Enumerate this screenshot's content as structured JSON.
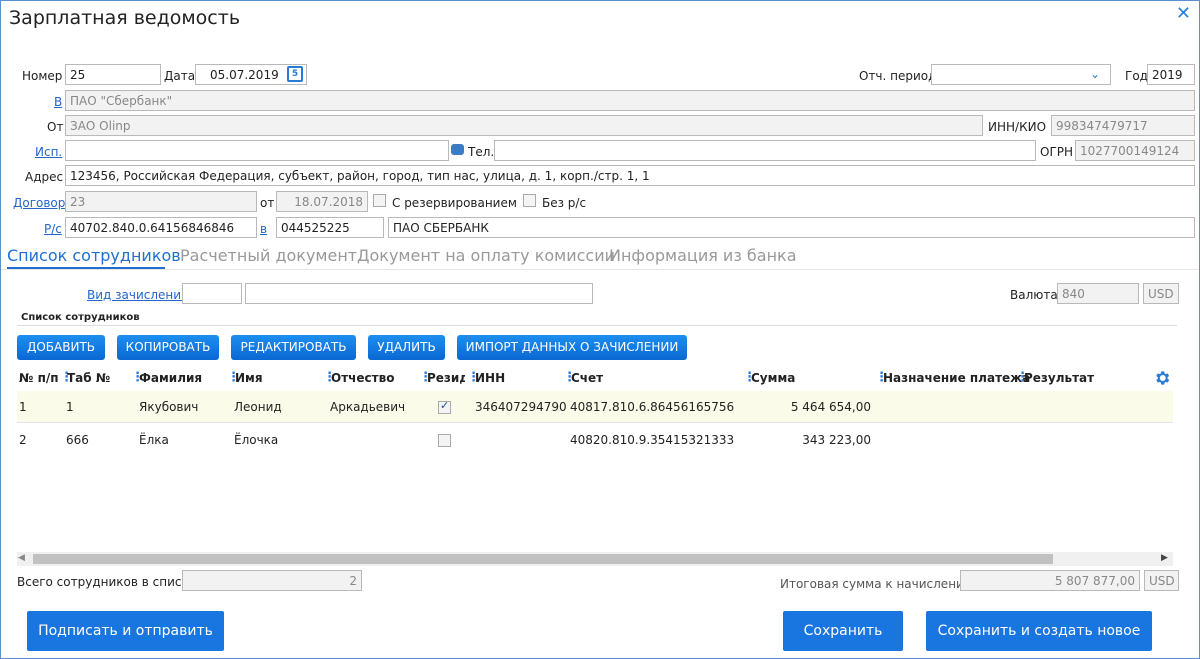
{
  "window": {
    "title": "Зарплатная ведомость"
  },
  "header": {
    "number_label": "Номер",
    "number_value": "25",
    "date_label": "Дата",
    "date_value": "05.07.2019",
    "period_label": "Отч. период",
    "period_value": "",
    "year_label": "Год",
    "year_value": "2019",
    "to_label": "В",
    "to_value": "ПАО \"Сбербанк\"",
    "from_label": "От",
    "from_value": "ЗАО Olinp",
    "inn_label": "ИНН/КИО",
    "inn_value": "998347479717",
    "exec_label": "Исп.",
    "exec_value": "",
    "tel_label": "Тел.",
    "tel_value": "",
    "ogrn_label": "ОГРН",
    "ogrn_value": "1027700149124",
    "address_label": "Адрес",
    "address_value": "123456, Российская Федерация, субъект, район, город, тип нас, улица, д. 1, корп./стр. 1, 1",
    "contract_label": "Договор",
    "contract_value": "23",
    "contract_from_label": "от",
    "contract_from_value": "18.07.2018",
    "reserve_label": "С резервированием",
    "no_account_label": "Без р/с",
    "account_label": "Р/с",
    "account_value": "40702.840.0.64156846846",
    "bank_label": "в",
    "bank_bic": "044525225",
    "bank_name": "ПАО СБЕРБАНК"
  },
  "tabs": [
    {
      "label": "Список сотрудников",
      "active": true
    },
    {
      "label": "Расчетный документ",
      "active": false
    },
    {
      "label": "Документ на оплату комиссии",
      "active": false
    },
    {
      "label": "Информация из банка",
      "active": false
    }
  ],
  "accrual": {
    "type_label": "Вид зачисления",
    "type_code": "",
    "type_name": "",
    "currency_label": "Валюта",
    "currency_code": "840",
    "currency_name": "USD"
  },
  "section_title": "Список сотрудников",
  "toolbar": {
    "add": "ДОБАВИТЬ",
    "copy": "КОПИРОВАТЬ",
    "edit": "РЕДАКТИРОВАТЬ",
    "delete": "УДАЛИТЬ",
    "import": "ИМПОРТ ДАННЫХ О ЗАЧИСЛЕНИИ"
  },
  "table": {
    "columns": [
      "№ п/п",
      "Таб №",
      "Фамилия",
      "Имя",
      "Отчество",
      "Резиде",
      "ИНН",
      "Счет",
      "Сумма",
      "Назначение платежа",
      "Результат"
    ],
    "rows": [
      {
        "num": "1",
        "tab": "1",
        "last": "Якубович",
        "first": "Леонид",
        "middle": "Аркадьевич",
        "resident": true,
        "inn": "346407294790",
        "account": "40817.810.6.86456165756",
        "sum": "5 464 654,00",
        "purpose": "",
        "result": ""
      },
      {
        "num": "2",
        "tab": "666",
        "last": "Ёлка",
        "first": "Ёлочка",
        "middle": "",
        "resident": false,
        "inn": "",
        "account": "40820.810.9.35415321333",
        "sum": "343 223,00",
        "purpose": "",
        "result": ""
      }
    ]
  },
  "footer": {
    "total_employees_label": "Всего сотрудников в списке",
    "total_employees_value": "2",
    "total_sum_label": "Итоговая сумма к начислению",
    "total_sum_value": "5 807 877,00",
    "total_sum_currency": "USD"
  },
  "actions": {
    "sign_send": "Подписать и отправить",
    "save": "Сохранить",
    "save_new": "Сохранить и создать новое"
  },
  "colors": {
    "accent": "#1f6fd0",
    "selected_row": "#fbfbe9"
  }
}
